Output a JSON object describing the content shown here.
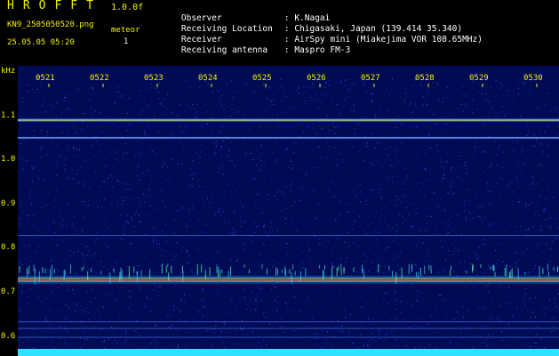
{
  "header": {
    "app_title": "HROFFT",
    "version": "1.0.0f",
    "filename": "KN9_2505050520.png",
    "meteor_label": "meteor",
    "meteor_count": "1",
    "datetime": "25.05.05 05:20"
  },
  "info": [
    {
      "label": "Observer",
      "value": ": K.Nagai"
    },
    {
      "label": "Receiving Location",
      "value": ": Chigasaki, Japan (139.414 35.340)"
    },
    {
      "label": "Receiver",
      "value": ": AirSpy mini (Miakejima VOR 108.65MHz)"
    },
    {
      "label": "Receiving antenna",
      "value": ": Maspro FM-3"
    }
  ],
  "colors": {
    "label_yellow": "#f2f200",
    "background_blue": "#000a55",
    "signal_red": "#ff2020",
    "noise_cyan": "#30e0ff"
  },
  "chart_data": {
    "type": "heatmap",
    "ylabel": "kHz",
    "y_ticks": [
      "1.1",
      "1.0",
      "0.9",
      "0.8",
      "0.7",
      "0.6"
    ],
    "x_ticks": [
      "0521",
      "0522",
      "0523",
      "0524",
      "0525",
      "0526",
      "0527",
      "0528",
      "0529",
      "0530"
    ],
    "ylim": [
      0.58,
      1.15
    ],
    "horizontal_lines_khz": [
      {
        "freq": 1.09,
        "strength": "medium"
      },
      {
        "freq": 1.05,
        "strength": "weak"
      },
      {
        "freq": 0.83,
        "strength": "faint"
      },
      {
        "freq": 0.73,
        "strength": "strong"
      },
      {
        "freq": 0.635,
        "strength": "faint"
      },
      {
        "freq": 0.62,
        "strength": "faint"
      },
      {
        "freq": 0.6,
        "strength": "faint"
      }
    ]
  }
}
